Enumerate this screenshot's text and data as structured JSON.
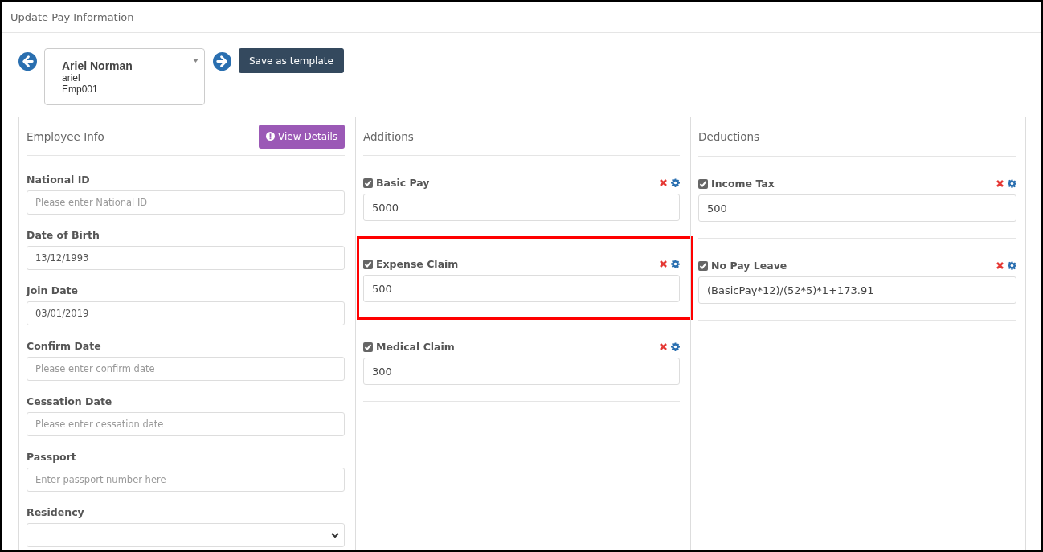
{
  "header": {
    "title": "Update Pay Information"
  },
  "employee_selector": {
    "name": "Ariel Norman",
    "username": "ariel",
    "code": "Emp001"
  },
  "save_button": "Save as template",
  "employee_info": {
    "title": "Employee Info",
    "view_details": "View Details",
    "fields": [
      {
        "label": "National ID",
        "kind": "text",
        "placeholder": "Please enter National ID"
      },
      {
        "label": "Date of Birth",
        "kind": "text",
        "value": "13/12/1993"
      },
      {
        "label": "Join Date",
        "kind": "text",
        "value": "03/01/2019"
      },
      {
        "label": "Confirm Date",
        "kind": "text",
        "placeholder": "Please enter confirm date"
      },
      {
        "label": "Cessation Date",
        "kind": "text",
        "placeholder": "Please enter cessation date"
      },
      {
        "label": "Passport",
        "kind": "text",
        "placeholder": "Enter passport number here"
      },
      {
        "label": "Residency",
        "kind": "select"
      }
    ]
  },
  "additions": {
    "title": "Additions",
    "items": [
      {
        "label": "Basic Pay",
        "checked": true,
        "value": "5000",
        "highlighted": false
      },
      {
        "label": "Expense Claim",
        "checked": true,
        "value": "500",
        "highlighted": true
      },
      {
        "label": "Medical Claim",
        "checked": true,
        "value": "300",
        "highlighted": false
      }
    ]
  },
  "deductions": {
    "title": "Deductions",
    "items": [
      {
        "label": "Income Tax",
        "checked": true,
        "value": "500",
        "highlighted": false
      },
      {
        "label": "No Pay Leave",
        "checked": true,
        "value": "(BasicPay*12)/(52*5)*1+173.91",
        "highlighted": false
      }
    ]
  }
}
